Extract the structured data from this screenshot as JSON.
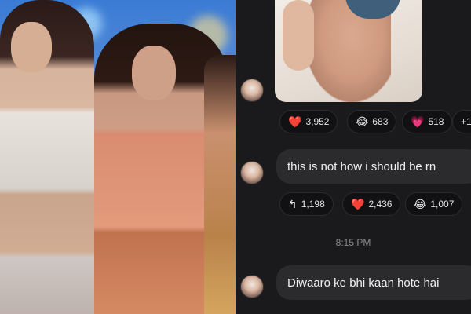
{
  "chat": {
    "reactions_row1": [
      {
        "icon": "heart",
        "glyph": "❤️",
        "count": "3,952",
        "color": "#e0245e"
      },
      {
        "icon": "laughing-face",
        "glyph": "😂",
        "count": "683"
      },
      {
        "icon": "sparkle-heart",
        "glyph": "💗",
        "count": "518"
      },
      {
        "icon": "more",
        "glyph": "",
        "count": "+1"
      }
    ],
    "message1": "this is not how i should be rn",
    "reactions_row2": [
      {
        "icon": "reply-arrow",
        "glyph": "↰",
        "count": "1,198"
      },
      {
        "icon": "heart",
        "glyph": "❤️",
        "count": "2,436"
      },
      {
        "icon": "laughing-face",
        "glyph": "😂",
        "count": "1,007"
      }
    ],
    "timestamp": "8:15 PM",
    "message2": "Diwaaro ke bhi kaan hote hai"
  }
}
